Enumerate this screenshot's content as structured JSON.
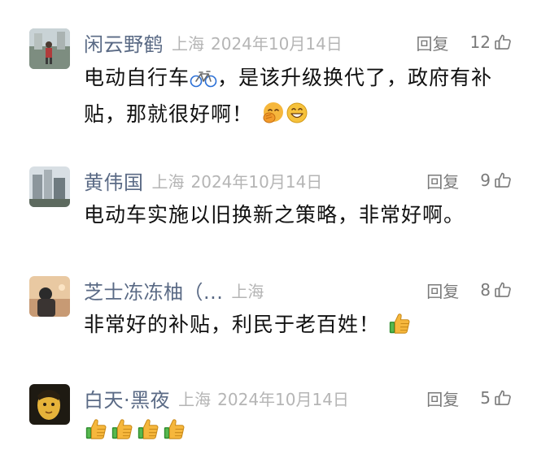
{
  "comments": [
    {
      "author": "闲云野鹤",
      "location": "上海",
      "date": "2024年10月14日",
      "reply_label": "回复",
      "likes": "12",
      "text_line1": "电动自行车",
      "text_line1_rest": "，是该升级换代了，政府有补",
      "text_line2": "贴，那就很好啊！",
      "emoji": [
        "bicycle-icon",
        "fingers-crossed-face-icon",
        "grinning-face-icon"
      ]
    },
    {
      "author": "黄伟国",
      "location": "上海",
      "date": "2024年10月14日",
      "reply_label": "回复",
      "likes": "9",
      "text": "电动车实施以旧换新之策略，非常好啊。"
    },
    {
      "author": "芝士冻冻柚（...",
      "location": "上海",
      "reply_label": "回复",
      "likes": "8",
      "text": "非常好的补贴，利民于老百姓！",
      "emoji": [
        "thumbs-up-icon"
      ]
    },
    {
      "author": "白天·黑夜",
      "location": "上海",
      "date": "2024年10月14日",
      "reply_label": "回复",
      "likes": "5",
      "emoji": [
        "thumbs-up-icon",
        "thumbs-up-icon",
        "thumbs-up-icon",
        "thumbs-up-icon"
      ]
    }
  ],
  "colors": {
    "author": "#5a6a85",
    "meta": "#b5b5b5",
    "action": "#7a7a7a",
    "text": "#111111",
    "emoji_yellow": "#f6b73c"
  }
}
